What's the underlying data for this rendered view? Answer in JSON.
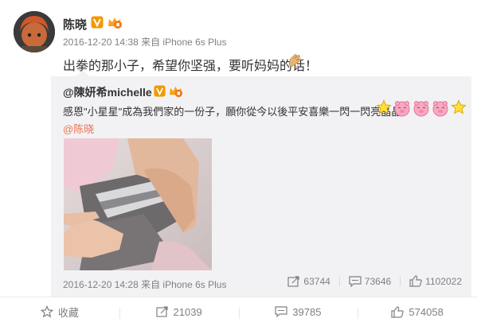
{
  "post": {
    "author": "陈晓",
    "time": "2016-12-20 14:38",
    "source": "来自 iPhone 6s Plus",
    "text": "出拳的那小子，希望你坚强，要听妈妈的话！"
  },
  "repost": {
    "author": "@陳妍希michelle",
    "text": "感恩\"小星星\"成為我們家的一份子，願你從今以後平安喜樂一閃一閃亮晶晶",
    "mention": "@陈晓",
    "time": "2016-12-20 14:28",
    "source": "来自 iPhone 6s Plus",
    "stats": {
      "reposts": "63744",
      "comments": "73646",
      "likes": "1102022"
    }
  },
  "footer": {
    "favorite_label": "收藏",
    "reposts": "21039",
    "comments": "39785",
    "likes": "574058"
  },
  "colors": {
    "link": "#eb7350",
    "meta": "#808080",
    "verified": "#f39800",
    "repost_bg": "#f2f2f5"
  }
}
